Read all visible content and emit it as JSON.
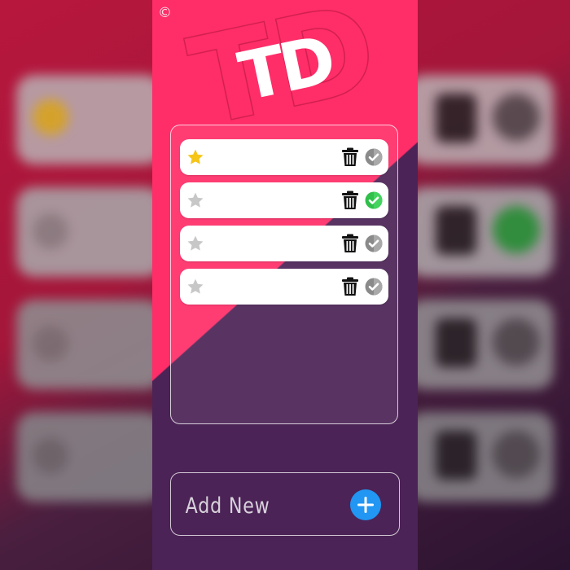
{
  "app": {
    "copyright_symbol": "©",
    "logo_text": "TD",
    "logo_color": "#ffffff",
    "watermark_text": "TD"
  },
  "colors": {
    "top_background": "#ff2d68",
    "bottom_background": "#4b2356",
    "star_active": "#f5c518",
    "star_inactive": "#c7c7c7",
    "check_done": "#2fbf4a",
    "check_pending": "#8a8a8a",
    "add_button": "#2196f3"
  },
  "todos": [
    {
      "starred": true,
      "completed": false,
      "text": ""
    },
    {
      "starred": false,
      "completed": true,
      "text": ""
    },
    {
      "starred": false,
      "completed": false,
      "text": ""
    },
    {
      "starred": false,
      "completed": false,
      "text": ""
    }
  ],
  "icons": {
    "star": "star-icon",
    "delete": "trash-icon",
    "complete": "checkmark-circle-icon",
    "add": "plus-circle-icon"
  },
  "add_new": {
    "placeholder": "Add New",
    "value": ""
  }
}
